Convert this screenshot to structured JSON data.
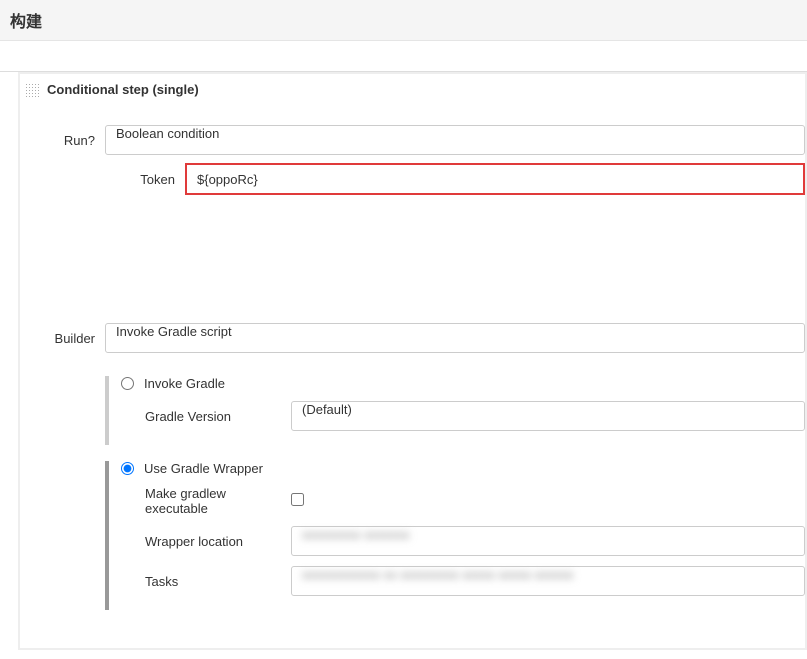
{
  "header": {
    "title": "构建"
  },
  "step": {
    "title": "Conditional step (single)"
  },
  "run": {
    "label": "Run?",
    "value": "Boolean condition",
    "token_label": "Token",
    "token_value": "${oppoRc}"
  },
  "builder": {
    "label": "Builder",
    "value": "Invoke Gradle script"
  },
  "gradle": {
    "invoke_label": "Invoke Gradle",
    "version_label": "Gradle Version",
    "version_value": "(Default)",
    "wrapper_label": "Use Gradle Wrapper",
    "make_exec_label": "Make gradlew executable",
    "wrapper_location_label": "Wrapper location",
    "wrapper_location_value": "xxxxxxxxx xxxxxxx",
    "tasks_label": "Tasks",
    "tasks_value": "xxxxxxxxxxxx xx xxxxxxxxx xxxxx xxxxx xxxxxx"
  }
}
